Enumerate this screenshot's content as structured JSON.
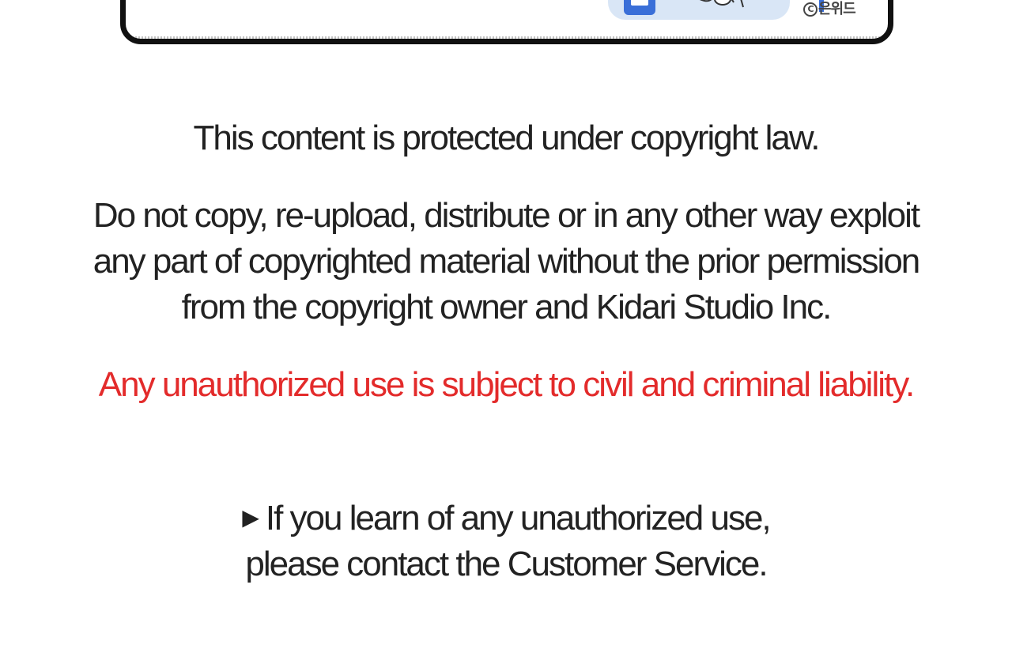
{
  "panel": {
    "watermark_text": "은위드",
    "accent_color": "#3a6fd8"
  },
  "notice": {
    "line_protected": "This content is protected under copyright law.",
    "line_do_not_copy_1": "Do not copy, re-upload, distribute or in any other way exploit",
    "line_do_not_copy_2": "any part of copyrighted material without the prior permission",
    "line_do_not_copy_3": "from the copyright owner and Kidari Studio Inc.",
    "line_liability": "Any unauthorized use is subject to civil and criminal liability.",
    "liability_color": "#e32b2b",
    "contact_bullet_icon": "triangle-right-icon",
    "contact_line_1": "If you learn of any unauthorized use,",
    "contact_line_2": "please contact the Customer Service."
  }
}
